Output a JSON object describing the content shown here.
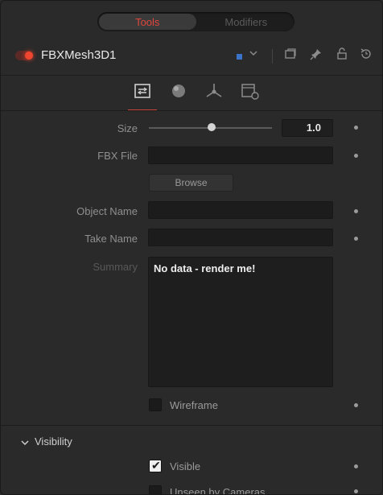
{
  "top_tabs": [
    {
      "label": "Tools",
      "active": true
    },
    {
      "label": "Modifiers",
      "active": false
    }
  ],
  "node": {
    "title": "FBXMesh3D1",
    "color_chip": "#3a73c8",
    "power_color": "#f0452f"
  },
  "header_icons": [
    "chevron-down-icon",
    "window-icon",
    "pin-icon",
    "lock-icon",
    "reset-icon"
  ],
  "icon_tabs": [
    {
      "name": "controls-tab-icon",
      "active": true
    },
    {
      "name": "materials-tab-icon",
      "active": false
    },
    {
      "name": "transform-tab-icon",
      "active": false
    },
    {
      "name": "settings-tab-icon",
      "active": false
    }
  ],
  "fields": {
    "size_label": "Size",
    "size_value": "1.0",
    "size_slider_fraction": 0.5,
    "fbx_file_label": "FBX File",
    "fbx_file_value": "",
    "browse_label": "Browse",
    "object_name_label": "Object Name",
    "object_name_value": "",
    "take_name_label": "Take Name",
    "take_name_value": "",
    "summary_label": "Summary",
    "summary_text": "No data - render me!",
    "wireframe_label": "Wireframe",
    "wireframe_checked": false
  },
  "visibility": {
    "section_label": "Visibility",
    "visible_label": "Visible",
    "visible_checked": true,
    "unseen_label": "Unseen by Cameras",
    "unseen_checked": false
  },
  "accent_color": "#d0453b"
}
